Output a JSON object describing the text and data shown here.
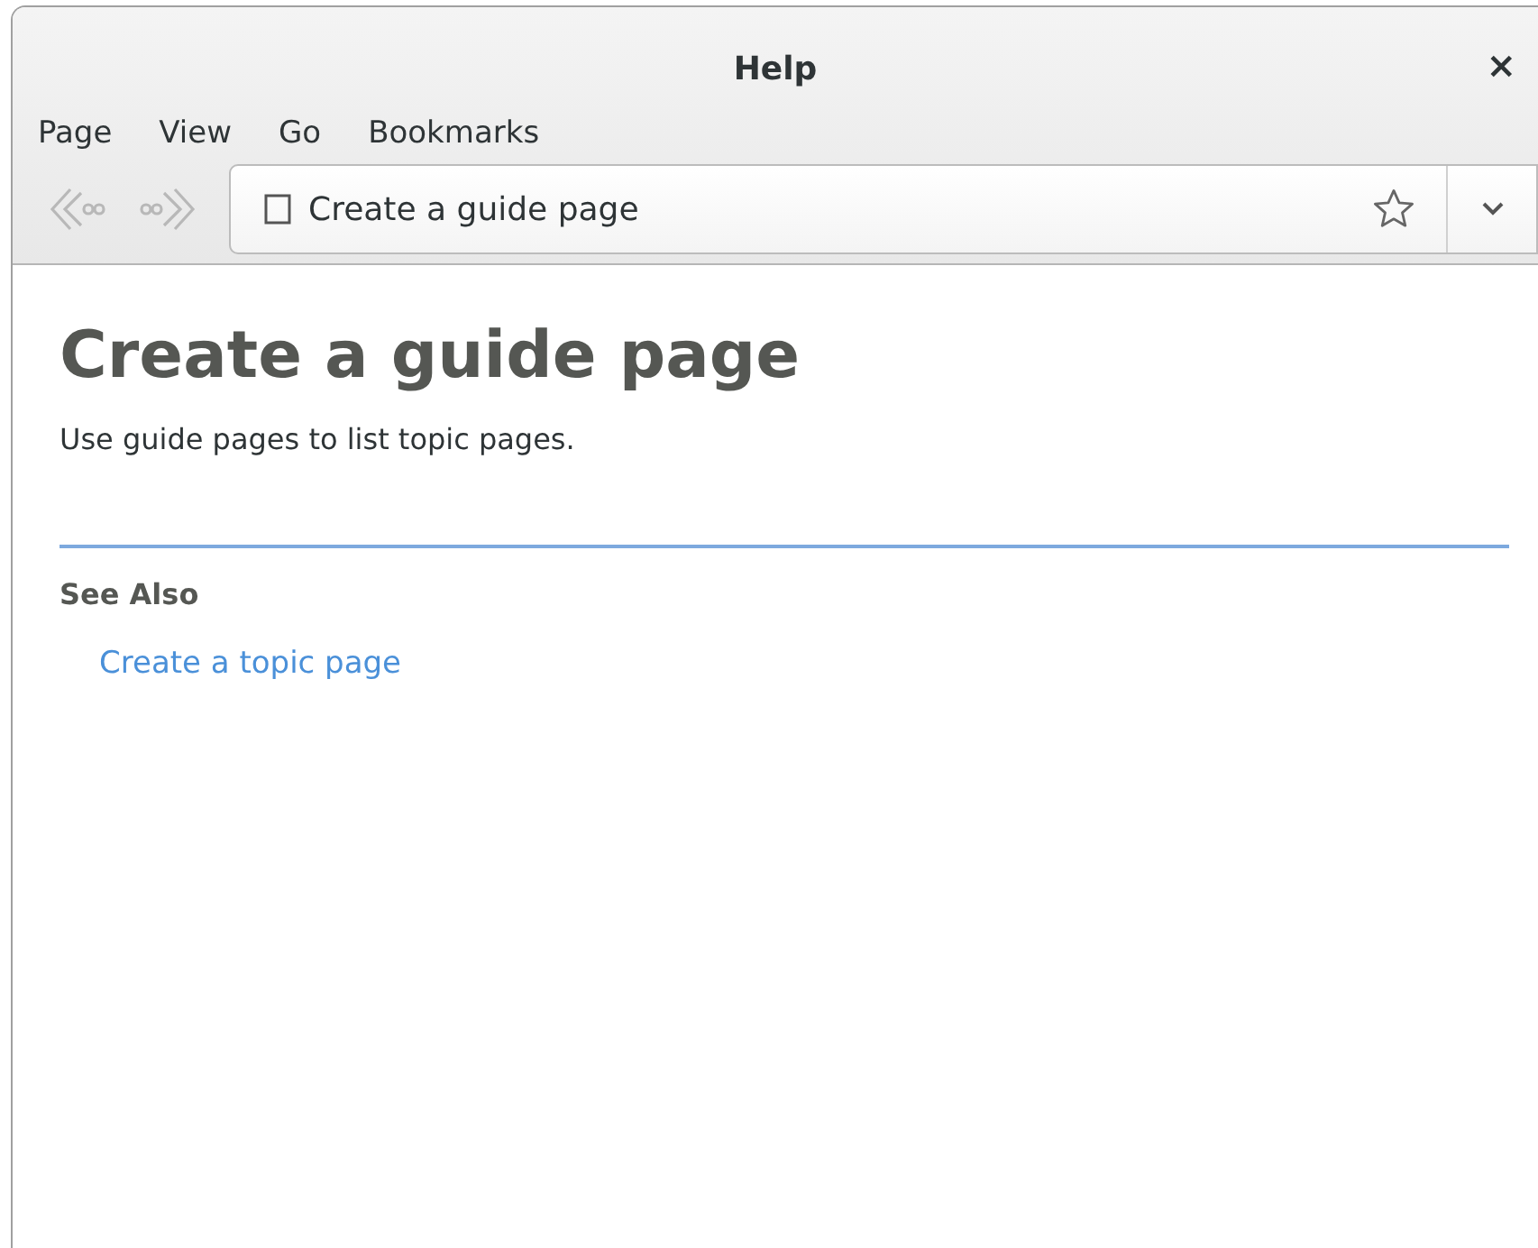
{
  "window": {
    "title": "Help",
    "close": "×"
  },
  "menu": [
    "Page",
    "View",
    "Go",
    "Bookmarks"
  ],
  "toolbar": {
    "back": {
      "disabled": true
    },
    "forward": {
      "disabled": true
    },
    "address": "Create a guide page"
  },
  "page": {
    "heading": "Create a guide page",
    "intro": "Use guide pages to list topic pages.",
    "see_also": {
      "title": "See Also",
      "links": [
        "Create a topic page"
      ]
    }
  }
}
